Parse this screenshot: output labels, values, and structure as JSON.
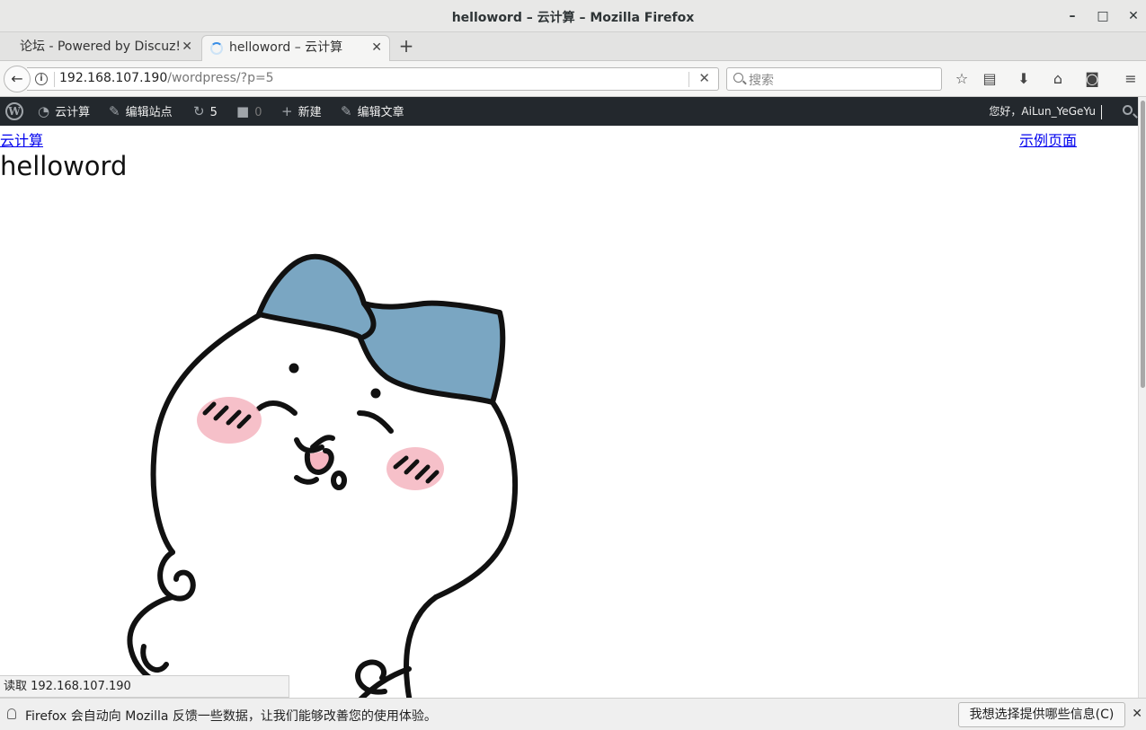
{
  "window": {
    "title": "helloword – 云计算  –  Mozilla Firefox",
    "minimize_glyph": "–",
    "maximize_glyph": "□",
    "close_glyph": "✕"
  },
  "tabs": [
    {
      "label": "论坛 - Powered by Discuz!",
      "close": "✕"
    },
    {
      "label": "helloword – 云计算",
      "close": "✕"
    }
  ],
  "newtab": "+",
  "nav": {
    "back_glyph": "←",
    "url_host": "192.168.107.190",
    "url_path": "/wordpress/?p=5",
    "clear_glyph": "✕",
    "search_placeholder": "搜索"
  },
  "toolbar_icons": [
    {
      "name": "bookmark-star-icon",
      "glyph": "☆"
    },
    {
      "name": "reading-list-icon",
      "glyph": "▤"
    },
    {
      "name": "downloads-icon",
      "glyph": "⬇"
    },
    {
      "name": "home-icon",
      "glyph": "⌂"
    },
    {
      "name": "pocket-icon",
      "glyph": "◙"
    },
    {
      "name": "menu-icon",
      "glyph": "≡"
    }
  ],
  "wpbar": {
    "logo": "W",
    "site_name": "云计算",
    "customize": "编辑站点",
    "updates_count": "5",
    "comments_count": "0",
    "new_label": "新建",
    "edit_post": "编辑文章",
    "greeting": "您好，AiLun_YeGeYu"
  },
  "page": {
    "site_link": "云计算",
    "sample_page_link": "示例页面",
    "post_title": "helloword"
  },
  "status_text": "读取 192.168.107.190",
  "notification": {
    "text": "Firefox 会自动向 Mozilla 反馈一些数据，让我们能够改善您的使用体验。",
    "choose_button": "我想选择提供哪些信息(C)",
    "close_glyph": "✕"
  }
}
